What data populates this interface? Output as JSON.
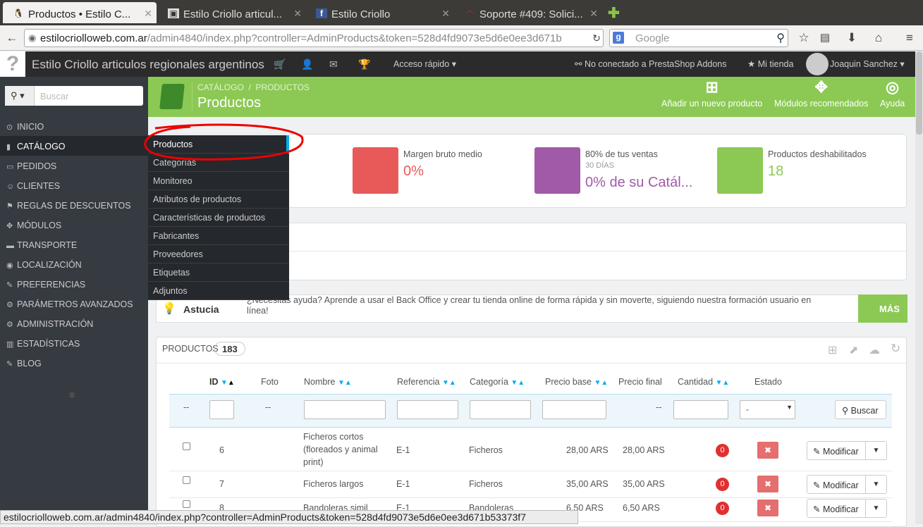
{
  "browser": {
    "tabs": [
      {
        "title": "Productos • Estilo C...",
        "icon": "prestashop-icon"
      },
      {
        "title": "Estilo Criollo articul...",
        "icon": "page-icon"
      },
      {
        "title": "Estilo Criollo",
        "icon": "facebook-icon"
      },
      {
        "title": "Soporte #409: Solici...",
        "icon": "support-icon"
      }
    ],
    "url_domain": "estilocriolloweb.com.ar",
    "url_path": "/admin4840/index.php?controller=AdminProducts&token=528d4fd9073e5d6e0ee3d671b",
    "search_placeholder": "Google",
    "status_url": "estilocriolloweb.com.ar/admin4840/index.php?controller=AdminProducts&token=528d4fd9073e5d6e0ee3d671b53373f7"
  },
  "header": {
    "shop_name": "Estilo Criollo articulos regionales argentinos",
    "quick_access": "Acceso rápido",
    "addons": "No conectado a PrestaShop Addons",
    "my_shop": "Mi tienda",
    "user": "Joaquin Sanchez"
  },
  "sidebar": {
    "search_placeholder": "Buscar",
    "items": [
      {
        "label": "Inicio",
        "icon": "dashboard-icon"
      },
      {
        "label": "Catálogo",
        "icon": "book-icon"
      },
      {
        "label": "Pedidos",
        "icon": "credit-card-icon"
      },
      {
        "label": "Clientes",
        "icon": "users-icon"
      },
      {
        "label": "Reglas de descuentos",
        "icon": "tag-icon"
      },
      {
        "label": "Módulos",
        "icon": "puzzle-icon"
      },
      {
        "label": "Transporte",
        "icon": "truck-icon"
      },
      {
        "label": "Localización",
        "icon": "globe-icon"
      },
      {
        "label": "Preferencias",
        "icon": "wrench-icon"
      },
      {
        "label": "Parámetros avanzados",
        "icon": "cogs-icon"
      },
      {
        "label": "Administración",
        "icon": "cog-icon"
      },
      {
        "label": "Estadísticas",
        "icon": "bar-chart-icon"
      },
      {
        "label": "Blog",
        "icon": "edit-icon"
      }
    ]
  },
  "submenu": [
    "Productos",
    "Categorías",
    "Monitoreo",
    "Atributos de productos",
    "Características de productos",
    "Fabricantes",
    "Proveedores",
    "Etiquetas",
    "Adjuntos"
  ],
  "toolbar": {
    "breadcrumb1": "CATÁLOGO",
    "breadcrumb2": "PRODUCTOS",
    "title": "Productos",
    "add": "Añadir un nuevo producto",
    "modules": "Módulos recomendados",
    "help": "Ayuda"
  },
  "kpis": [
    {
      "label": "Margen bruto medio",
      "sub": "",
      "value": "0%",
      "color": "#e85a5a"
    },
    {
      "label": "80% de tus ventas",
      "sub": "30 DÍAS",
      "value": "0% de su Catál...",
      "color": "#a15aa8"
    },
    {
      "label": "Productos deshabilitados",
      "sub": "",
      "value": "18",
      "color": "#8bc954"
    }
  ],
  "tip": {
    "title": "Astucia",
    "text": "¿Necesitas ayuda? Aprende a usar el Back Office y crear tu tienda online de forma rápida y sin moverte, siguiendo nuestra formación usuario en línea!",
    "more": "MÁS"
  },
  "products": {
    "heading": "PRODUCTOS",
    "count": "183",
    "columns": [
      "ID",
      "Foto",
      "Nombre",
      "Referencia",
      "Categoría",
      "Precio base",
      "Precio final",
      "Cantidad",
      "Estado"
    ],
    "filter_dash": "--",
    "filter_select": "-",
    "search_btn": "Buscar",
    "rows": [
      {
        "id": "6",
        "name_lines": [
          "Ficheros cortos",
          "(floreados y animal",
          "print)"
        ],
        "ref": "E-1",
        "cat": "Ficheros",
        "base": "28,00 ARS",
        "final": "28,00 ARS",
        "qty": "0"
      },
      {
        "id": "7",
        "name_lines": [
          "Ficheros largos"
        ],
        "ref": "E-1",
        "cat": "Ficheros",
        "base": "35,00 ARS",
        "final": "35,00 ARS",
        "qty": "0"
      },
      {
        "id": "8",
        "name_lines": [
          "Bandoleras simil"
        ],
        "ref": "E-1",
        "cat": "Bandoleras",
        "base": "6,50 ARS",
        "final": "6,50 ARS",
        "qty": "0"
      }
    ],
    "edit_label": "Modificar"
  }
}
